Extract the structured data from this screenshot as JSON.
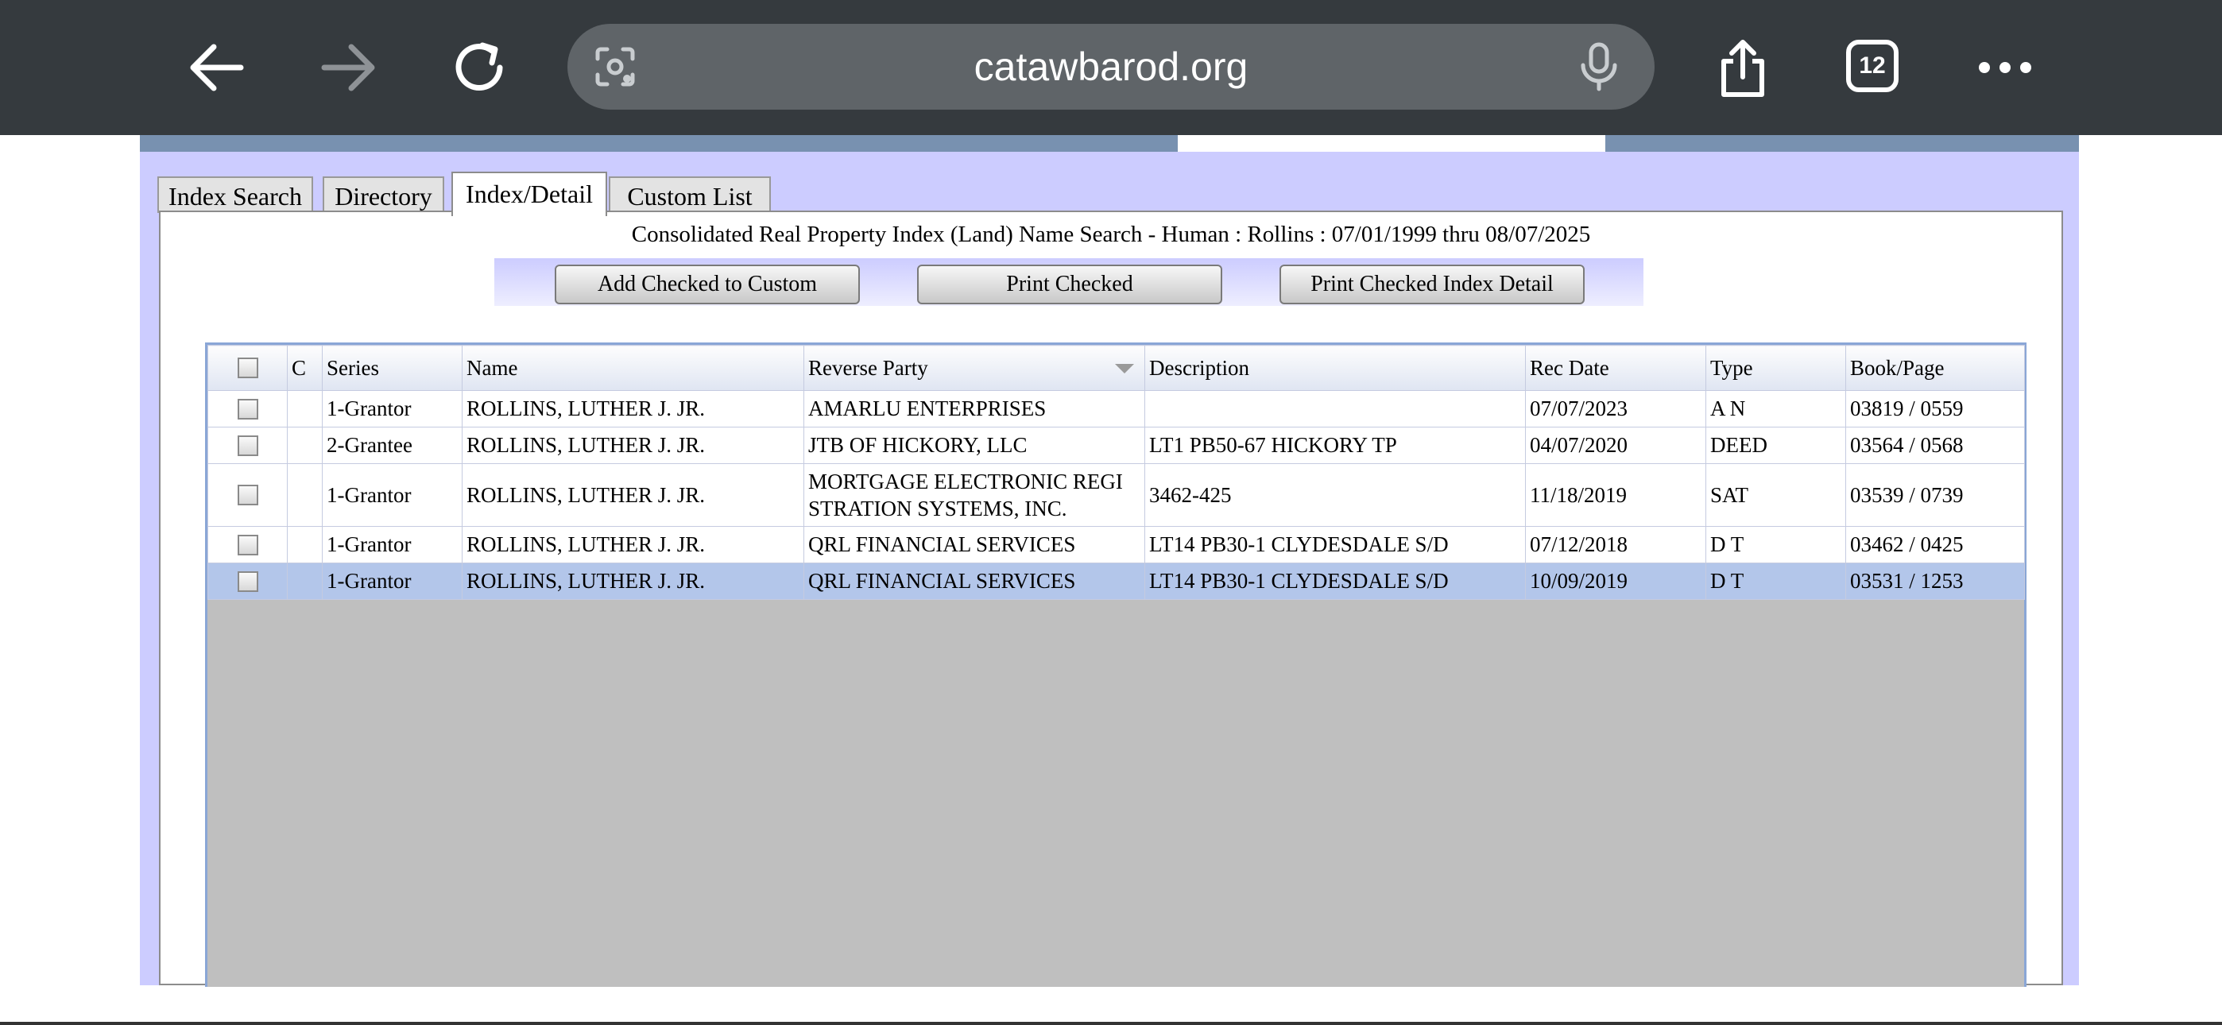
{
  "browser": {
    "url": "catawbarod.org",
    "tab_count": "12",
    "icons": {
      "back": "back-arrow-icon",
      "forward": "forward-arrow-icon",
      "reload": "reload-icon",
      "lens": "camera-lens-icon",
      "mic": "microphone-icon",
      "share": "share-icon",
      "tabs": "tab-switcher-icon",
      "more": "more-dots-icon"
    }
  },
  "tabs": [
    "Index Search",
    "Directory",
    "Index/Detail",
    "Custom List"
  ],
  "active_tab": "Index/Detail",
  "search_title": "Consolidated Real Property Index (Land) Name Search - Human : Rollins : 07/01/1999 thru 08/07/2025",
  "buttons": {
    "add_custom": "Add Checked to Custom",
    "print_checked": "Print Checked",
    "print_index_detail": "Print Checked Index Detail"
  },
  "table": {
    "columns": [
      "C",
      "Series",
      "Name",
      "Reverse Party",
      "Description",
      "Rec Date",
      "Type",
      "Book/Page"
    ],
    "rows": [
      {
        "series": "1-Grantor",
        "name": "ROLLINS, LUTHER J. JR.",
        "reverse_party": "AMARLU ENTERPRISES",
        "description": "",
        "rec_date": "07/07/2023",
        "type": "A N",
        "book_page": "03819 / 0559"
      },
      {
        "series": "2-Grantee",
        "name": "ROLLINS, LUTHER J. JR.",
        "reverse_party": "JTB OF HICKORY, LLC",
        "description": "LT1 PB50-67 HICKORY TP",
        "rec_date": "04/07/2020",
        "type": "DEED",
        "book_page": "03564 / 0568"
      },
      {
        "series": "1-Grantor",
        "name": "ROLLINS, LUTHER J. JR.",
        "reverse_party": "MORTGAGE ELECTRONIC REGI STRATION SYSTEMS, INC.",
        "description": "3462-425",
        "rec_date": "11/18/2019",
        "type": "SAT",
        "book_page": "03539 / 0739"
      },
      {
        "series": "1-Grantor",
        "name": "ROLLINS, LUTHER J. JR.",
        "reverse_party": "QRL FINANCIAL SERVICES",
        "description": "LT14 PB30-1 CLYDESDALE S/D",
        "rec_date": "07/12/2018",
        "type": "D T",
        "book_page": "03462 / 0425"
      },
      {
        "series": "1-Grantor",
        "name": "ROLLINS, LUTHER J. JR.",
        "reverse_party": "QRL FINANCIAL SERVICES",
        "description": "LT14 PB30-1 CLYDESDALE S/D",
        "rec_date": "10/09/2019",
        "type": "D T",
        "book_page": "03531 / 1253",
        "selected": true
      }
    ]
  }
}
